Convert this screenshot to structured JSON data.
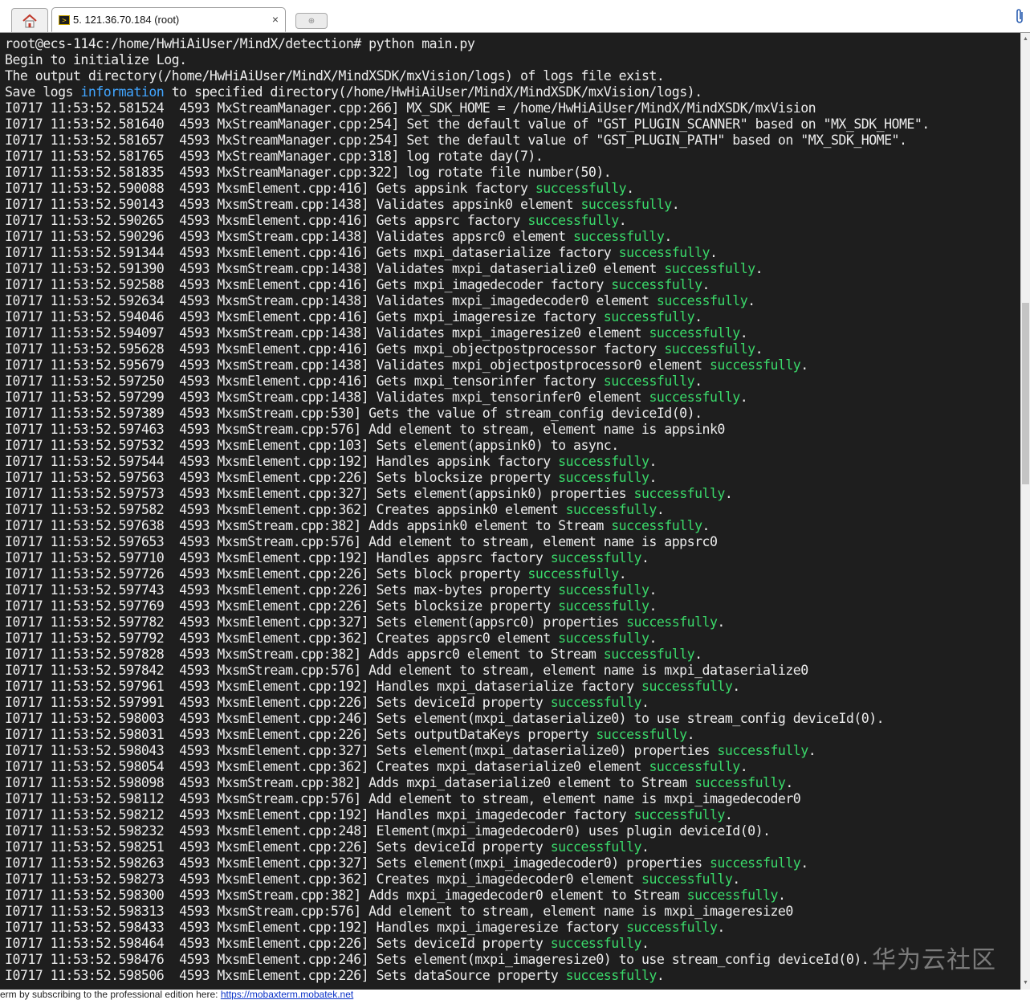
{
  "tabs": {
    "home_label": "",
    "session_title": "5. 121.36.70.184 (root)",
    "close_glyph": "×",
    "new_tab_glyph": "⊕"
  },
  "terminal": {
    "lines": [
      [
        {
          "t": "root@ecs-114c:/home/HwHiAiUser/MindX/detection# python main.py"
        }
      ],
      [
        {
          "t": "Begin to initialize Log."
        }
      ],
      [
        {
          "t": "The output directory(/home/HwHiAiUser/MindX/MindXSDK/mxVision/logs) of logs file exist."
        }
      ],
      [
        {
          "t": "Save logs "
        },
        {
          "t": "information",
          "c": "info"
        },
        {
          "t": " to specified directory(/home/HwHiAiUser/MindX/MindXSDK/mxVision/logs)."
        }
      ],
      [
        {
          "t": "I0717 11:53:52.581524  4593 MxStreamManager.cpp:266] MX_SDK_HOME = /home/HwHiAiUser/MindX/MindXSDK/mxVision"
        }
      ],
      [
        {
          "t": "I0717 11:53:52.581640  4593 MxStreamManager.cpp:254] Set the default value of \"GST_PLUGIN_SCANNER\" based on \"MX_SDK_HOME\"."
        }
      ],
      [
        {
          "t": "I0717 11:53:52.581657  4593 MxStreamManager.cpp:254] Set the default value of \"GST_PLUGIN_PATH\" based on \"MX_SDK_HOME\"."
        }
      ],
      [
        {
          "t": "I0717 11:53:52.581765  4593 MxStreamManager.cpp:318] log rotate day(7)."
        }
      ],
      [
        {
          "t": "I0717 11:53:52.581835  4593 MxStreamManager.cpp:322] log rotate file number(50)."
        }
      ],
      [
        {
          "t": "I0717 11:53:52.590088  4593 MxsmElement.cpp:416] Gets appsink factory "
        },
        {
          "t": "successfully",
          "c": "ok"
        },
        {
          "t": "."
        }
      ],
      [
        {
          "t": "I0717 11:53:52.590143  4593 MxsmStream.cpp:1438] Validates appsink0 element "
        },
        {
          "t": "successfully",
          "c": "ok"
        },
        {
          "t": "."
        }
      ],
      [
        {
          "t": "I0717 11:53:52.590265  4593 MxsmElement.cpp:416] Gets appsrc factory "
        },
        {
          "t": "successfully",
          "c": "ok"
        },
        {
          "t": "."
        }
      ],
      [
        {
          "t": "I0717 11:53:52.590296  4593 MxsmStream.cpp:1438] Validates appsrc0 element "
        },
        {
          "t": "successfully",
          "c": "ok"
        },
        {
          "t": "."
        }
      ],
      [
        {
          "t": "I0717 11:53:52.591344  4593 MxsmElement.cpp:416] Gets mxpi_dataserialize factory "
        },
        {
          "t": "successfully",
          "c": "ok"
        },
        {
          "t": "."
        }
      ],
      [
        {
          "t": "I0717 11:53:52.591390  4593 MxsmStream.cpp:1438] Validates mxpi_dataserialize0 element "
        },
        {
          "t": "successfully",
          "c": "ok"
        },
        {
          "t": "."
        }
      ],
      [
        {
          "t": "I0717 11:53:52.592588  4593 MxsmElement.cpp:416] Gets mxpi_imagedecoder factory "
        },
        {
          "t": "successfully",
          "c": "ok"
        },
        {
          "t": "."
        }
      ],
      [
        {
          "t": "I0717 11:53:52.592634  4593 MxsmStream.cpp:1438] Validates mxpi_imagedecoder0 element "
        },
        {
          "t": "successfully",
          "c": "ok"
        },
        {
          "t": "."
        }
      ],
      [
        {
          "t": "I0717 11:53:52.594046  4593 MxsmElement.cpp:416] Gets mxpi_imageresize factory "
        },
        {
          "t": "successfully",
          "c": "ok"
        },
        {
          "t": "."
        }
      ],
      [
        {
          "t": "I0717 11:53:52.594097  4593 MxsmStream.cpp:1438] Validates mxpi_imageresize0 element "
        },
        {
          "t": "successfully",
          "c": "ok"
        },
        {
          "t": "."
        }
      ],
      [
        {
          "t": "I0717 11:53:52.595628  4593 MxsmElement.cpp:416] Gets mxpi_objectpostprocessor factory "
        },
        {
          "t": "successfully",
          "c": "ok"
        },
        {
          "t": "."
        }
      ],
      [
        {
          "t": "I0717 11:53:52.595679  4593 MxsmStream.cpp:1438] Validates mxpi_objectpostprocessor0 element "
        },
        {
          "t": "successfully",
          "c": "ok"
        },
        {
          "t": "."
        }
      ],
      [
        {
          "t": "I0717 11:53:52.597250  4593 MxsmElement.cpp:416] Gets mxpi_tensorinfer factory "
        },
        {
          "t": "successfully",
          "c": "ok"
        },
        {
          "t": "."
        }
      ],
      [
        {
          "t": "I0717 11:53:52.597299  4593 MxsmStream.cpp:1438] Validates mxpi_tensorinfer0 element "
        },
        {
          "t": "successfully",
          "c": "ok"
        },
        {
          "t": "."
        }
      ],
      [
        {
          "t": "I0717 11:53:52.597389  4593 MxsmStream.cpp:530] Gets the value of stream_config deviceId(0)."
        }
      ],
      [
        {
          "t": "I0717 11:53:52.597463  4593 MxsmStream.cpp:576] Add element to stream, element name is appsink0"
        }
      ],
      [
        {
          "t": "I0717 11:53:52.597532  4593 MxsmElement.cpp:103] Sets element(appsink0) to async."
        }
      ],
      [
        {
          "t": "I0717 11:53:52.597544  4593 MxsmElement.cpp:192] Handles appsink factory "
        },
        {
          "t": "successfully",
          "c": "ok"
        },
        {
          "t": "."
        }
      ],
      [
        {
          "t": "I0717 11:53:52.597563  4593 MxsmElement.cpp:226] Sets blocksize property "
        },
        {
          "t": "successfully",
          "c": "ok"
        },
        {
          "t": "."
        }
      ],
      [
        {
          "t": "I0717 11:53:52.597573  4593 MxsmElement.cpp:327] Sets element(appsink0) properties "
        },
        {
          "t": "successfully",
          "c": "ok"
        },
        {
          "t": "."
        }
      ],
      [
        {
          "t": "I0717 11:53:52.597582  4593 MxsmElement.cpp:362] Creates appsink0 element "
        },
        {
          "t": "successfully",
          "c": "ok"
        },
        {
          "t": "."
        }
      ],
      [
        {
          "t": "I0717 11:53:52.597638  4593 MxsmStream.cpp:382] Adds appsink0 element to Stream "
        },
        {
          "t": "successfully",
          "c": "ok"
        },
        {
          "t": "."
        }
      ],
      [
        {
          "t": "I0717 11:53:52.597653  4593 MxsmStream.cpp:576] Add element to stream, element name is appsrc0"
        }
      ],
      [
        {
          "t": "I0717 11:53:52.597710  4593 MxsmElement.cpp:192] Handles appsrc factory "
        },
        {
          "t": "successfully",
          "c": "ok"
        },
        {
          "t": "."
        }
      ],
      [
        {
          "t": "I0717 11:53:52.597726  4593 MxsmElement.cpp:226] Sets block property "
        },
        {
          "t": "successfully",
          "c": "ok"
        },
        {
          "t": "."
        }
      ],
      [
        {
          "t": "I0717 11:53:52.597743  4593 MxsmElement.cpp:226] Sets max-bytes property "
        },
        {
          "t": "successfully",
          "c": "ok"
        },
        {
          "t": "."
        }
      ],
      [
        {
          "t": "I0717 11:53:52.597769  4593 MxsmElement.cpp:226] Sets blocksize property "
        },
        {
          "t": "successfully",
          "c": "ok"
        },
        {
          "t": "."
        }
      ],
      [
        {
          "t": "I0717 11:53:52.597782  4593 MxsmElement.cpp:327] Sets element(appsrc0) properties "
        },
        {
          "t": "successfully",
          "c": "ok"
        },
        {
          "t": "."
        }
      ],
      [
        {
          "t": "I0717 11:53:52.597792  4593 MxsmElement.cpp:362] Creates appsrc0 element "
        },
        {
          "t": "successfully",
          "c": "ok"
        },
        {
          "t": "."
        }
      ],
      [
        {
          "t": "I0717 11:53:52.597828  4593 MxsmStream.cpp:382] Adds appsrc0 element to Stream "
        },
        {
          "t": "successfully",
          "c": "ok"
        },
        {
          "t": "."
        }
      ],
      [
        {
          "t": "I0717 11:53:52.597842  4593 MxsmStream.cpp:576] Add element to stream, element name is mxpi_dataserialize0"
        }
      ],
      [
        {
          "t": "I0717 11:53:52.597961  4593 MxsmElement.cpp:192] Handles mxpi_dataserialize factory "
        },
        {
          "t": "successfully",
          "c": "ok"
        },
        {
          "t": "."
        }
      ],
      [
        {
          "t": "I0717 11:53:52.597991  4593 MxsmElement.cpp:226] Sets deviceId property "
        },
        {
          "t": "successfully",
          "c": "ok"
        },
        {
          "t": "."
        }
      ],
      [
        {
          "t": "I0717 11:53:52.598003  4593 MxsmElement.cpp:246] Sets element(mxpi_dataserialize0) to use stream_config deviceId(0)."
        }
      ],
      [
        {
          "t": "I0717 11:53:52.598031  4593 MxsmElement.cpp:226] Sets outputDataKeys property "
        },
        {
          "t": "successfully",
          "c": "ok"
        },
        {
          "t": "."
        }
      ],
      [
        {
          "t": "I0717 11:53:52.598043  4593 MxsmElement.cpp:327] Sets element(mxpi_dataserialize0) properties "
        },
        {
          "t": "successfully",
          "c": "ok"
        },
        {
          "t": "."
        }
      ],
      [
        {
          "t": "I0717 11:53:52.598054  4593 MxsmElement.cpp:362] Creates mxpi_dataserialize0 element "
        },
        {
          "t": "successfully",
          "c": "ok"
        },
        {
          "t": "."
        }
      ],
      [
        {
          "t": "I0717 11:53:52.598098  4593 MxsmStream.cpp:382] Adds mxpi_dataserialize0 element to Stream "
        },
        {
          "t": "successfully",
          "c": "ok"
        },
        {
          "t": "."
        }
      ],
      [
        {
          "t": "I0717 11:53:52.598112  4593 MxsmStream.cpp:576] Add element to stream, element name is mxpi_imagedecoder0"
        }
      ],
      [
        {
          "t": "I0717 11:53:52.598212  4593 MxsmElement.cpp:192] Handles mxpi_imagedecoder factory "
        },
        {
          "t": "successfully",
          "c": "ok"
        },
        {
          "t": "."
        }
      ],
      [
        {
          "t": "I0717 11:53:52.598232  4593 MxsmElement.cpp:248] Element(mxpi_imagedecoder0) uses plugin deviceId(0)."
        }
      ],
      [
        {
          "t": "I0717 11:53:52.598251  4593 MxsmElement.cpp:226] Sets deviceId property "
        },
        {
          "t": "successfully",
          "c": "ok"
        },
        {
          "t": "."
        }
      ],
      [
        {
          "t": "I0717 11:53:52.598263  4593 MxsmElement.cpp:327] Sets element(mxpi_imagedecoder0) properties "
        },
        {
          "t": "successfully",
          "c": "ok"
        },
        {
          "t": "."
        }
      ],
      [
        {
          "t": "I0717 11:53:52.598273  4593 MxsmElement.cpp:362] Creates mxpi_imagedecoder0 element "
        },
        {
          "t": "successfully",
          "c": "ok"
        },
        {
          "t": "."
        }
      ],
      [
        {
          "t": "I0717 11:53:52.598300  4593 MxsmStream.cpp:382] Adds mxpi_imagedecoder0 element to Stream "
        },
        {
          "t": "successfully",
          "c": "ok"
        },
        {
          "t": "."
        }
      ],
      [
        {
          "t": "I0717 11:53:52.598313  4593 MxsmStream.cpp:576] Add element to stream, element name is mxpi_imageresize0"
        }
      ],
      [
        {
          "t": "I0717 11:53:52.598433  4593 MxsmElement.cpp:192] Handles mxpi_imageresize factory "
        },
        {
          "t": "successfully",
          "c": "ok"
        },
        {
          "t": "."
        }
      ],
      [
        {
          "t": "I0717 11:53:52.598464  4593 MxsmElement.cpp:226] Sets deviceId property "
        },
        {
          "t": "successfully",
          "c": "ok"
        },
        {
          "t": "."
        }
      ],
      [
        {
          "t": "I0717 11:53:52.598476  4593 MxsmElement.cpp:246] Sets element(mxpi_imageresize0) to use stream_config deviceId(0)."
        }
      ],
      [
        {
          "t": "I0717 11:53:52.598506  4593 MxsmElement.cpp:226] Sets dataSource property "
        },
        {
          "t": "successfully",
          "c": "ok"
        },
        {
          "t": "."
        }
      ]
    ]
  },
  "status_bar": {
    "text": "erm by subscribing to the professional edition here: ",
    "link_text": "https://mobaxterm.mobatek.net"
  },
  "watermark": "华为云社区",
  "colors": {
    "terminal_bg": "#1e1e1e",
    "terminal_fg": "#ececec",
    "highlight_info": "#41a5ff",
    "highlight_success": "#3ad96a"
  }
}
